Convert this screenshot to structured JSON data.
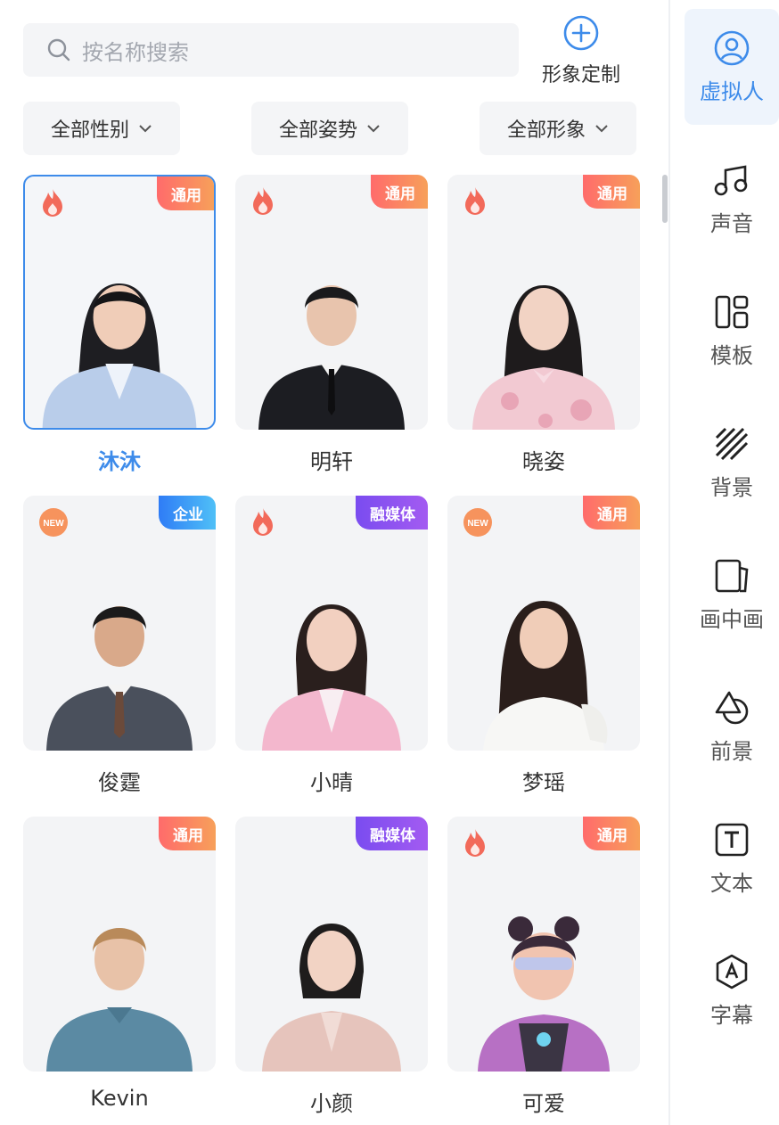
{
  "search": {
    "placeholder": "按名称搜索"
  },
  "custom": {
    "label": "形象定制"
  },
  "filters": [
    {
      "label": "全部性别"
    },
    {
      "label": "全部姿势"
    },
    {
      "label": "全部形象"
    }
  ],
  "cards": [
    {
      "name": "沐沐",
      "badge": "通用",
      "badge_type": "tongyong",
      "icon": "fire-icon",
      "selected": true
    },
    {
      "name": "明轩",
      "badge": "通用",
      "badge_type": "tongyong",
      "icon": "fire-icon"
    },
    {
      "name": "晓姿",
      "badge": "通用",
      "badge_type": "tongyong",
      "icon": "fire-icon"
    },
    {
      "name": "俊霆",
      "badge": "企业",
      "badge_type": "qiye",
      "icon": "new-icon"
    },
    {
      "name": "小晴",
      "badge": "融媒体",
      "badge_type": "rongmeiti",
      "icon": "fire-icon"
    },
    {
      "name": "梦瑶",
      "badge": "通用",
      "badge_type": "tongyong",
      "icon": "new-icon"
    },
    {
      "name": "Kevin",
      "badge": "通用",
      "badge_type": "tongyong",
      "icon": ""
    },
    {
      "name": "小颜",
      "badge": "融媒体",
      "badge_type": "rongmeiti",
      "icon": ""
    },
    {
      "name": "可爱",
      "badge": "通用",
      "badge_type": "tongyong",
      "icon": "fire-icon"
    }
  ],
  "sidebar": {
    "items": [
      {
        "label": "虚拟人",
        "icon": "avatar-icon",
        "active": true
      },
      {
        "label": "声音",
        "icon": "music-note-icon"
      },
      {
        "label": "模板",
        "icon": "template-icon"
      },
      {
        "label": "背景",
        "icon": "background-icon"
      },
      {
        "label": "画中画",
        "icon": "picture-in-picture-icon"
      },
      {
        "label": "前景",
        "icon": "foreground-icon"
      },
      {
        "label": "文本",
        "icon": "text-icon"
      },
      {
        "label": "字幕",
        "icon": "subtitle-icon"
      }
    ]
  },
  "colors": {
    "accent": "#3d8bea",
    "badge_tongyong": "#f7875f",
    "badge_qiye": "#3a95f6",
    "badge_rongmeiti": "#8a52f0"
  },
  "new_badge_text": "NEW"
}
